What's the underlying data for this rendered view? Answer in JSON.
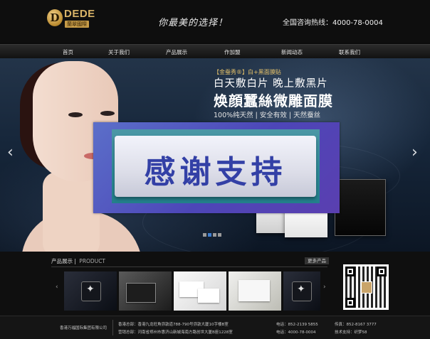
{
  "header": {
    "logo_mark": "D",
    "logo_text": "DEDE",
    "logo_sub": "蘭翠國際",
    "slogan": "你最美的选择！",
    "hotline": "全国咨询热线：4000-78-0004"
  },
  "nav": {
    "items": [
      "首页",
      "关于我们",
      "产品展示",
      "作加盟",
      "新闻动态",
      "联系我们"
    ]
  },
  "banner": {
    "tag": "【金蚕秀®】白+黑面膜贴",
    "line1": "白天敷白片  晚上敷黑片",
    "line2": "焕顔蠶絲微雕面膜",
    "line3": "100%纯天然 | 安全有效 | 天然蚕丝",
    "prev_arrow": "‹",
    "next_arrow": "›",
    "slides_total": 4,
    "active_slide": 1
  },
  "overlay": {
    "text": "感谢支持"
  },
  "products": {
    "title": "产品展示",
    "title_sub": "PRODUCT",
    "more": "更多产品",
    "prev_arrow": "‹",
    "next_arrow": "›"
  },
  "footer": {
    "company": "香港万福国际集团有限公司",
    "hk_office": "香港总部：香港九龙旺角弥敦道788-790号弥敦大厦10字楼B室",
    "hn_office": "营销总部：河南省郑州市惠济山新城海南方路创世大厦B座1228室",
    "phone1": "电话：852-2139 5855",
    "phone2": "电话：4000-78-0004",
    "fax": "传真：852-8167 3777",
    "support": "技术支持：织梦58"
  },
  "colors": {
    "accent_gold": "#d9b468",
    "stamp_text": "#3340a6",
    "active_dot": "#3f7fd0"
  }
}
